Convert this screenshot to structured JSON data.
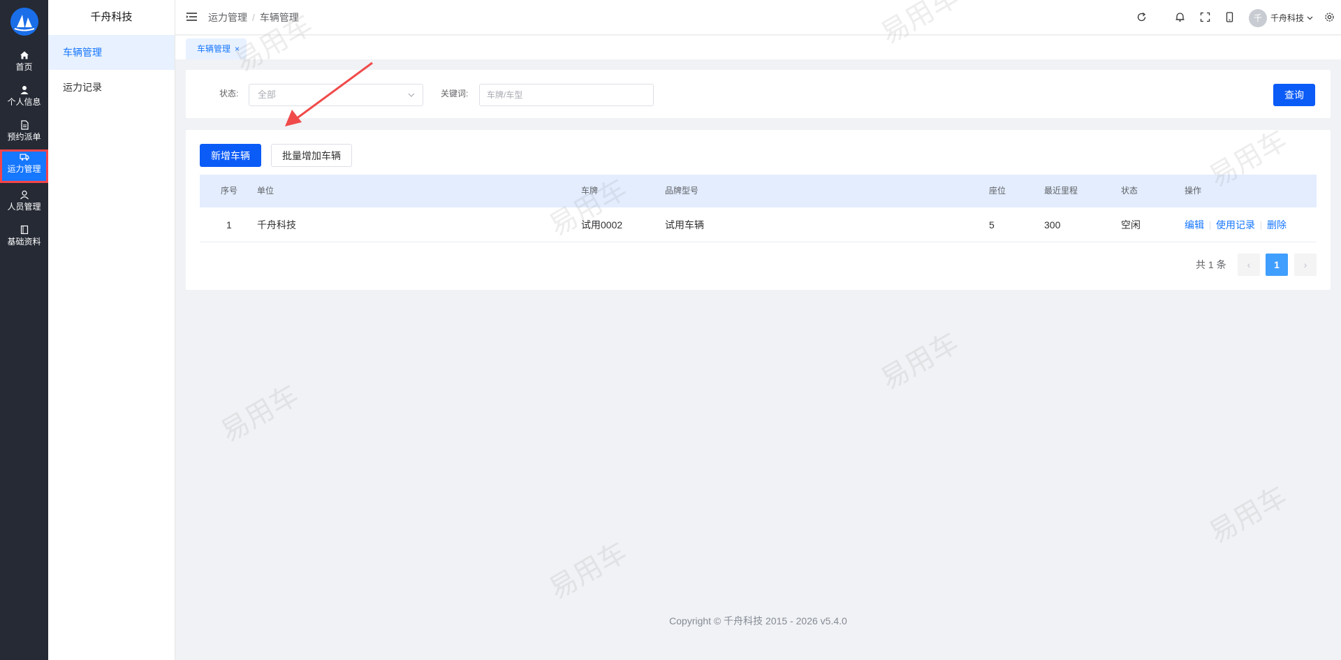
{
  "rail": {
    "items": [
      {
        "label": "首页"
      },
      {
        "label": "个人信息"
      },
      {
        "label": "预约派单"
      },
      {
        "label": "运力管理"
      },
      {
        "label": "人员管理"
      },
      {
        "label": "基础资料"
      }
    ]
  },
  "submenu": {
    "title": "千舟科技",
    "items": [
      {
        "label": "车辆管理"
      },
      {
        "label": "运力记录"
      }
    ]
  },
  "header": {
    "breadcrumb": [
      "运力管理",
      "车辆管理"
    ],
    "breadcrumb_sep": "/",
    "user": {
      "avatar_text": "千",
      "name": "千舟科技"
    }
  },
  "tags": [
    {
      "label": "车辆管理",
      "close": "×"
    }
  ],
  "search": {
    "status_label": "状态:",
    "status_value": "全部",
    "keyword_label": "关键词:",
    "keyword_placeholder": "车牌/车型",
    "keyword_value": "",
    "query_label": "查询"
  },
  "toolbar": {
    "add_label": "新增车辆",
    "batch_add_label": "批量增加车辆"
  },
  "table": {
    "columns": [
      "序号",
      "单位",
      "车牌",
      "品牌型号",
      "座位",
      "最近里程",
      "状态",
      "操作"
    ],
    "rows": [
      {
        "index": "1",
        "unit": "千舟科技",
        "plate": "试用0002",
        "model": "试用车辆",
        "seats": "5",
        "mileage": "300",
        "status": "空闲",
        "actions": [
          "编辑",
          "使用记录",
          "删除"
        ]
      }
    ]
  },
  "pagination": {
    "total_text": "共 1 条",
    "prev": "‹",
    "current": "1",
    "next": "›"
  },
  "footer": {
    "copyright": "Copyright © 千舟科技 2015 - 2026 v5.4.0"
  },
  "watermark": {
    "text": "易用车"
  },
  "colors": {
    "primary": "#0b5bf7",
    "link": "#1677ff",
    "rail_bg": "#252a34",
    "highlight_border": "#f5454a"
  }
}
